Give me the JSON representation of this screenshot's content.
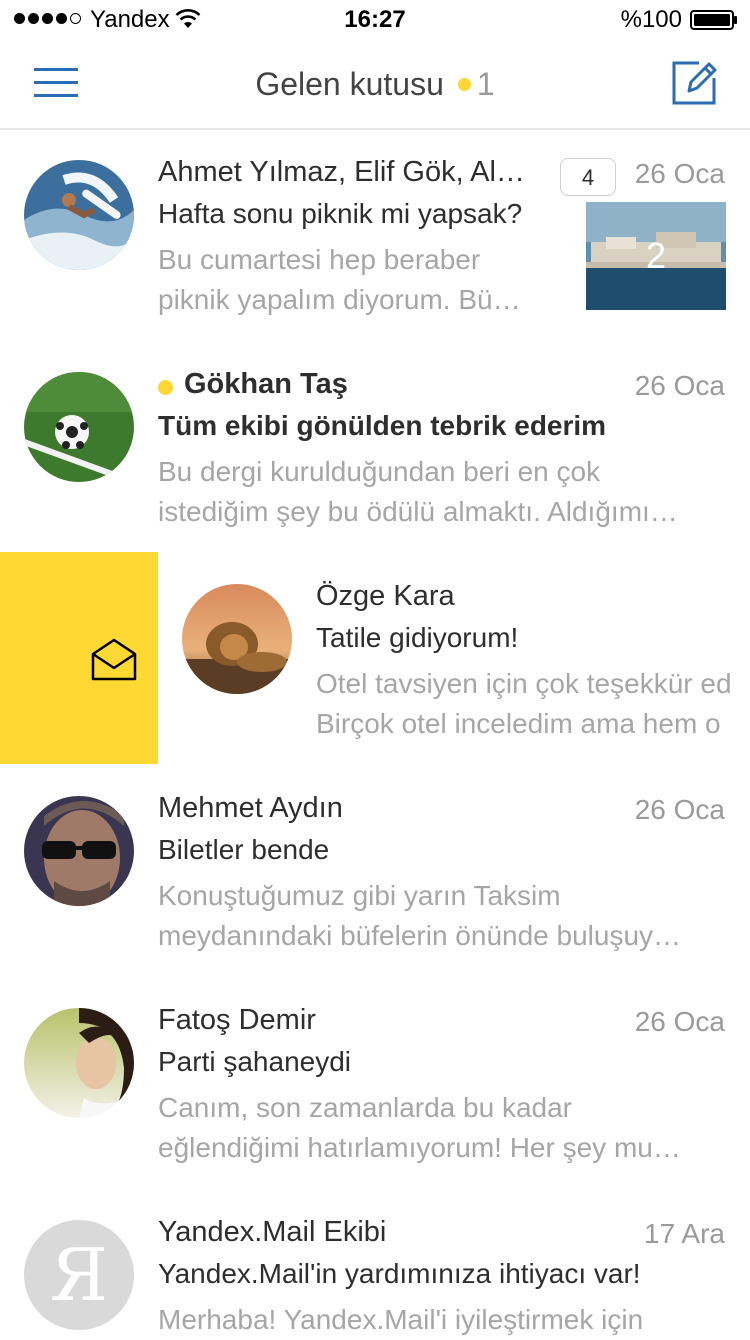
{
  "status_bar": {
    "carrier": "Yandex",
    "time": "16:27",
    "battery": "%100"
  },
  "nav": {
    "title": "Gelen kutusu",
    "unread_count": "1",
    "accent_color": "#2a6db4",
    "unread_color": "#ffd633"
  },
  "messages": [
    {
      "sender": "Ahmet Yılmaz, Elif Gök, Al…",
      "subject": "Hafta sonu piknik mi yapsak?",
      "preview1": "Bu cumartesi hep beraber",
      "preview2": "piknik yapalım diyorum. Bü…",
      "date": "26 Oca",
      "thread_count": "4",
      "attachment_count": "2",
      "avatar_icon": "surfer-avatar"
    },
    {
      "sender": "Gökhan Taş",
      "subject": "Tüm ekibi gönülden tebrik ederim",
      "preview1": "Bu dergi kurulduğundan beri en çok",
      "preview2": "istediğim şey bu ödülü almaktı. Aldığımı…",
      "date": "26 Oca",
      "unread": true,
      "avatar_icon": "soccer-ball-avatar"
    },
    {
      "sender": "Özge Kara",
      "subject": "Tatile gidiyorum!",
      "preview1": "Otel tavsiyen için çok teşekkür ed",
      "preview2": "Birçok otel inceledim ama hem o",
      "swipe_action_icon": "open-envelope-icon",
      "avatar_icon": "lion-avatar"
    },
    {
      "sender": "Mehmet Aydın",
      "subject": "Biletler bende",
      "preview1": "Konuştuğumuz gibi yarın Taksim",
      "preview2": "meydanındaki büfelerin önünde buluşuy…",
      "date": "26 Oca",
      "avatar_icon": "man-sunglasses-avatar"
    },
    {
      "sender": "Fatoş Demir",
      "subject": "Parti şahaneydi",
      "preview1": "Canım, son zamanlarda bu kadar",
      "preview2": "eğlendiğimi hatırlamıyorum! Her şey mu…",
      "date": "26 Oca",
      "avatar_icon": "woman-avatar"
    },
    {
      "sender": "Yandex.Mail Ekibi",
      "subject": "Yandex.Mail'in yardımınıza ihtiyacı var!",
      "preview1": "Merhaba! Yandex.Mail'i iyileştirmek için",
      "date": "17 Ara",
      "avatar_letter": "Я"
    }
  ]
}
